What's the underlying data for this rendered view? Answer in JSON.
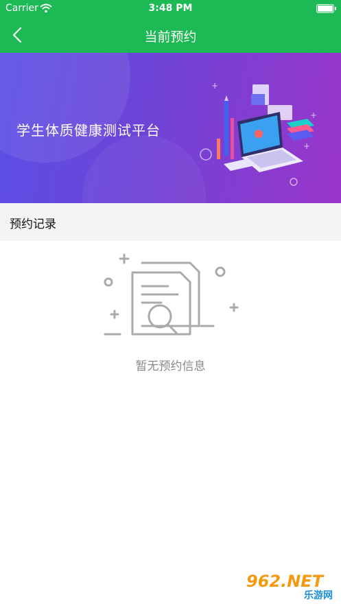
{
  "status_bar": {
    "carrier": "Carrier",
    "time": "3:48 PM"
  },
  "navbar": {
    "title": "当前预约",
    "back_icon": "chevron-left-icon"
  },
  "banner": {
    "title": "学生体质健康测试平台"
  },
  "section": {
    "title": "预约记录"
  },
  "empty_state": {
    "icon": "document-search-icon",
    "message": "暂无预约信息"
  },
  "watermark": {
    "brand": "962.NET",
    "sub": "乐游网"
  },
  "colors": {
    "primary": "#1db954",
    "banner_start": "#5a4fe6",
    "banner_end": "#9a36c9",
    "empty_text": "#888888"
  }
}
